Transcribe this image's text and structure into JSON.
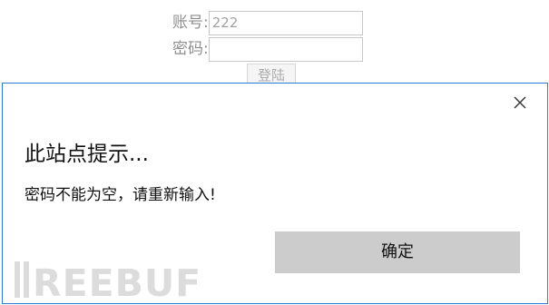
{
  "login_form": {
    "account_label": "账号:",
    "account_value": "222",
    "password_label": "密码:",
    "password_value": "",
    "login_button_label": "登陆"
  },
  "dialog": {
    "title": "此站点提示...",
    "message": "密码不能为空，请重新输入!",
    "ok_button_label": "确定",
    "close_icon": "close-icon",
    "border_color": "#2b7bd3"
  },
  "watermark": {
    "text": "FREEBUF"
  }
}
